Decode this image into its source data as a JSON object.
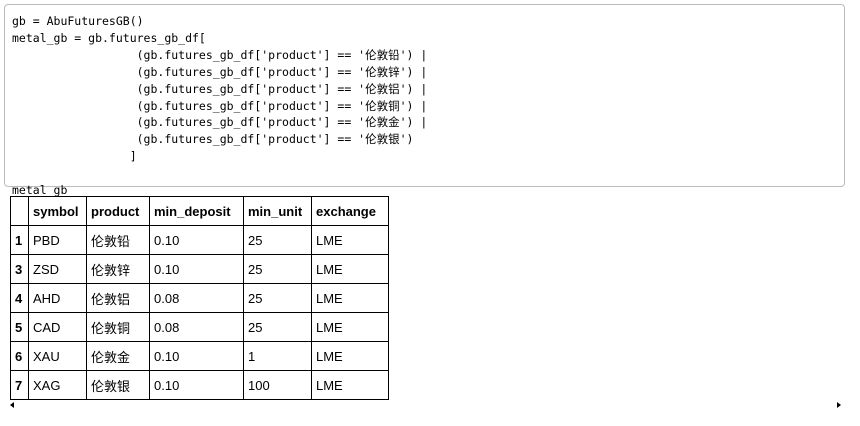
{
  "code_cell": {
    "lines": [
      "gb = AbuFuturesGB()",
      "metal_gb = gb.futures_gb_df[",
      "                  (gb.futures_gb_df['product'] == '伦敦铅') |",
      "                  (gb.futures_gb_df['product'] == '伦敦锌') |",
      "                  (gb.futures_gb_df['product'] == '伦敦铝') |",
      "                  (gb.futures_gb_df['product'] == '伦敦铜') |",
      "                  (gb.futures_gb_df['product'] == '伦敦金') |",
      "                  (gb.futures_gb_df['product'] == '伦敦银')",
      "                 ]",
      "",
      "metal_gb"
    ]
  },
  "table": {
    "columns": [
      "",
      "symbol",
      "product",
      "min_deposit",
      "min_unit",
      "exchange"
    ],
    "rows": [
      {
        "index": "1",
        "symbol": "PBD",
        "product": "伦敦铅",
        "min_deposit": "0.10",
        "min_unit": "25",
        "exchange": "LME"
      },
      {
        "index": "3",
        "symbol": "ZSD",
        "product": "伦敦锌",
        "min_deposit": "0.10",
        "min_unit": "25",
        "exchange": "LME"
      },
      {
        "index": "4",
        "symbol": "AHD",
        "product": "伦敦铝",
        "min_deposit": "0.08",
        "min_unit": "25",
        "exchange": "LME"
      },
      {
        "index": "5",
        "symbol": "CAD",
        "product": "伦敦铜",
        "min_deposit": "0.08",
        "min_unit": "25",
        "exchange": "LME"
      },
      {
        "index": "6",
        "symbol": "XAU",
        "product": "伦敦金",
        "min_deposit": "0.10",
        "min_unit": "1",
        "exchange": "LME"
      },
      {
        "index": "7",
        "symbol": "XAG",
        "product": "伦敦银",
        "min_deposit": "0.10",
        "min_unit": "100",
        "exchange": "LME"
      }
    ]
  }
}
